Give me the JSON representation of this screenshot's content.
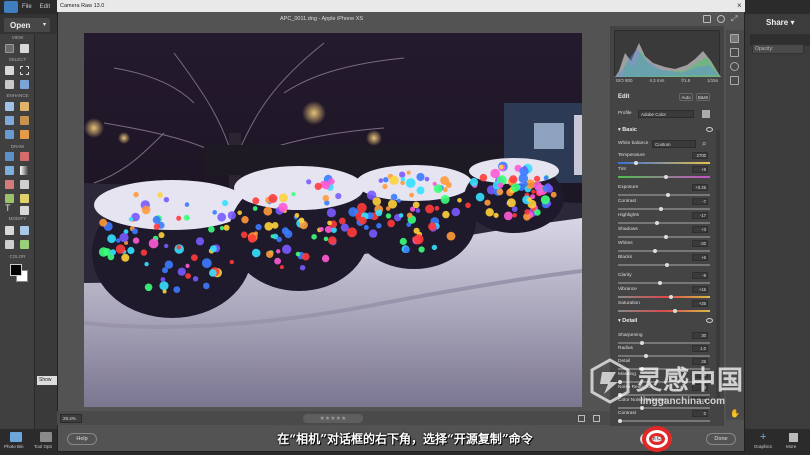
{
  "host": {
    "menu": [
      "File",
      "Edit"
    ],
    "open_label": "Open",
    "share_label": "Share",
    "opacity_label": "Opacity:",
    "toolbox_sections": [
      "VIEW",
      "SELECT",
      "ENHANCE",
      "DRAW",
      "MODIFY",
      "COLOR"
    ],
    "bottom": {
      "photo_bin": "Photo Bin",
      "tool_options": "Tool Opti",
      "graphics": "Graphics",
      "more": "More"
    },
    "show_label": "Show"
  },
  "dialog": {
    "title": "Camera Raw 13.0",
    "file_title": "APC_0011.dng  -  Apple iPhone XS",
    "zoom": "29.4%",
    "rating_stars": "★★★★★",
    "help": "Help",
    "open_copy": "Open Copy",
    "done": "Done"
  },
  "panel": {
    "exif": [
      "ISO 800",
      "4.3 mm",
      "f/1.8",
      "1/15s"
    ],
    "edit_title": "Edit",
    "auto": "Auto",
    "bw": "B&W",
    "profile_label": "Profile",
    "profile_value": "Adobe Color",
    "basic_title": "Basic",
    "white_balance_label": "White balance",
    "white_balance_value": "Custom",
    "sliders": [
      {
        "label": "Temperature",
        "value": "2700",
        "pos": 0.18
      },
      {
        "label": "Tint",
        "value": "+8",
        "pos": 0.52
      },
      {
        "label": "Exposure",
        "value": "+0.25",
        "pos": 0.54
      },
      {
        "label": "Contrast",
        "value": "-7",
        "pos": 0.47
      },
      {
        "label": "Highlights",
        "value": "-17",
        "pos": 0.42
      },
      {
        "label": "Shadows",
        "value": "+3",
        "pos": 0.52
      },
      {
        "label": "Whites",
        "value": "-20",
        "pos": 0.4
      },
      {
        "label": "Blacks",
        "value": "+6",
        "pos": 0.53
      },
      {
        "label": "Clarity",
        "value": "-9",
        "pos": 0.46
      },
      {
        "label": "Vibrance",
        "value": "+15",
        "pos": 0.58
      },
      {
        "label": "Saturation",
        "value": "+25",
        "pos": 0.62
      }
    ],
    "detail_title": "Detail",
    "detail_sliders": [
      {
        "label": "Sharpening",
        "value": "30",
        "pos": 0.25
      },
      {
        "label": "Radius",
        "value": "1.0",
        "pos": 0.3
      },
      {
        "label": "Detail",
        "value": "25",
        "pos": 0.25
      },
      {
        "label": "Masking",
        "value": "0",
        "pos": 0.0
      },
      {
        "label": "Noise Reduction",
        "value": "0",
        "pos": 0.0
      },
      {
        "label": "Color Noise Reduction",
        "value": "25",
        "pos": 0.25
      },
      {
        "label": "Contrast",
        "value": "0",
        "pos": 0.0
      }
    ]
  },
  "subtitle": "在“相机”对话框的右下角，选择“开源复制”命令",
  "watermark": {
    "name": "灵感中国",
    "url": "lingganchina.com"
  }
}
